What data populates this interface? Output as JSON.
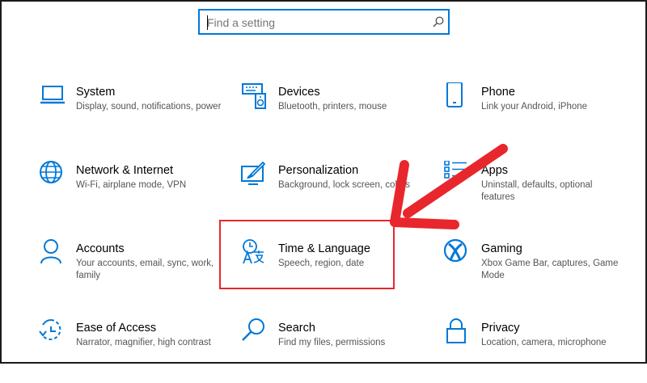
{
  "search": {
    "placeholder": "Find a setting"
  },
  "tiles": [
    {
      "title": "System",
      "desc": "Display, sound, notifications, power",
      "icon": "laptop-icon"
    },
    {
      "title": "Devices",
      "desc": "Bluetooth, printers, mouse",
      "icon": "keyboard-speaker-icon"
    },
    {
      "title": "Phone",
      "desc": "Link your Android, iPhone",
      "icon": "phone-icon"
    },
    {
      "title": "Network & Internet",
      "desc": "Wi-Fi, airplane mode, VPN",
      "icon": "globe-icon"
    },
    {
      "title": "Personalization",
      "desc": "Background, lock screen, colors",
      "icon": "paint-brush-icon"
    },
    {
      "title": "Apps",
      "desc": "Uninstall, defaults, optional features",
      "icon": "apps-list-icon"
    },
    {
      "title": "Accounts",
      "desc": "Your accounts, email, sync, work, family",
      "icon": "person-icon"
    },
    {
      "title": "Time & Language",
      "desc": "Speech, region, date",
      "icon": "time-language-icon"
    },
    {
      "title": "Gaming",
      "desc": "Xbox Game Bar, captures, Game Mode",
      "icon": "xbox-icon"
    },
    {
      "title": "Ease of Access",
      "desc": "Narrator, magnifier, high contrast",
      "icon": "ease-of-access-icon"
    },
    {
      "title": "Search",
      "desc": "Find my files, permissions",
      "icon": "search-icon"
    },
    {
      "title": "Privacy",
      "desc": "Location, camera, microphone",
      "icon": "lock-icon"
    }
  ],
  "colors": {
    "accent": "#0078d7",
    "annotation": "#e8272c"
  }
}
